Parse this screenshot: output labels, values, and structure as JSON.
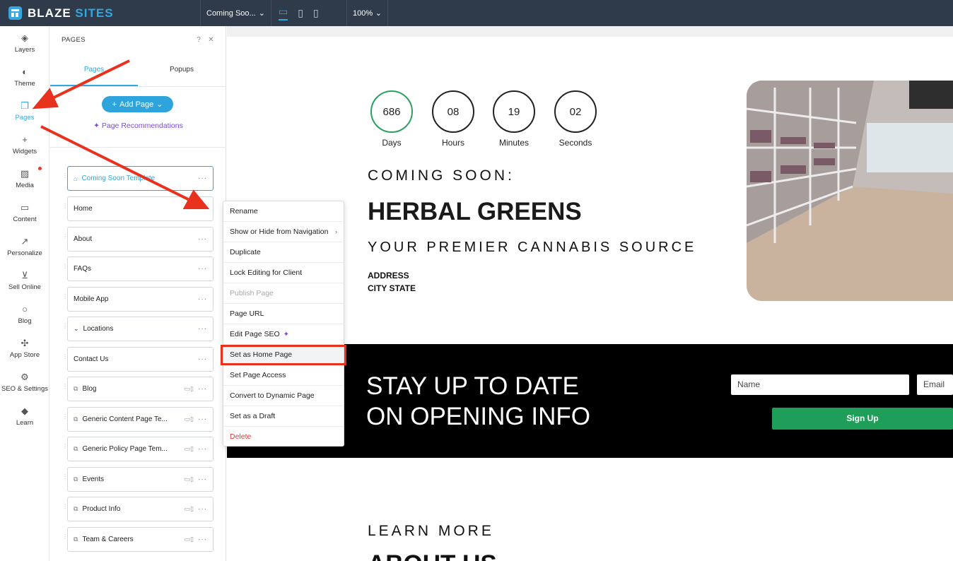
{
  "topbar": {
    "brand_a": "BLAZE",
    "brand_b": "SITES",
    "current_page": "Coming Soo...",
    "zoom": "100%"
  },
  "rail": [
    {
      "label": "Layers",
      "icon": "layers-icon"
    },
    {
      "label": "Theme",
      "icon": "palette-icon"
    },
    {
      "label": "Pages",
      "icon": "pages-icon"
    },
    {
      "label": "Widgets",
      "icon": "plus-icon"
    },
    {
      "label": "Media",
      "icon": "image-icon"
    },
    {
      "label": "Content",
      "icon": "folder-icon"
    },
    {
      "label": "Personalize",
      "icon": "personalize-icon"
    },
    {
      "label": "Sell Online",
      "icon": "cart-icon"
    },
    {
      "label": "Blog",
      "icon": "chat-icon"
    },
    {
      "label": "App Store",
      "icon": "puzzle-icon"
    },
    {
      "label": "SEO & Settings",
      "icon": "gear-icon"
    },
    {
      "label": "Learn",
      "icon": "graduation-cap-icon"
    }
  ],
  "panel": {
    "title": "PAGES",
    "tabs": [
      "Pages",
      "Popups"
    ],
    "add_page": "Add Page",
    "recommendations": "Page Recommendations",
    "pages": [
      {
        "label": "Coming Soon Template",
        "selected": true
      },
      {
        "label": "Home"
      },
      {
        "label": "About"
      },
      {
        "label": "FAQs"
      },
      {
        "label": "Mobile App"
      },
      {
        "label": "Locations"
      },
      {
        "label": "Contact Us"
      },
      {
        "label": "Blog"
      },
      {
        "label": "Generic Content Page Te..."
      },
      {
        "label": "Generic Policy Page Tem..."
      },
      {
        "label": "Events"
      },
      {
        "label": "Product Info"
      },
      {
        "label": "Team & Careers"
      }
    ]
  },
  "menu": [
    "Rename",
    "Show or Hide from Navigation",
    "Duplicate",
    "Lock Editing for Client",
    "Publish Page",
    "Page URL",
    "Edit Page SEO",
    "Set as Home Page",
    "Set Page Access",
    "Convert to Dynamic Page",
    "Set as a Draft",
    "Delete"
  ],
  "site": {
    "countdown": [
      {
        "value": "686",
        "label": "Days"
      },
      {
        "value": "08",
        "label": "Hours"
      },
      {
        "value": "19",
        "label": "Minutes"
      },
      {
        "value": "02",
        "label": "Seconds"
      }
    ],
    "coming": "COMING SOON:",
    "brand": "HERBAL GREENS",
    "tagline": "YOUR PREMIER CANNABIS SOURCE",
    "address_1": "ADDRESS",
    "address_2": "CITY STATE",
    "band_line1": "STAY UP TO DATE",
    "band_line2": "ON OPENING INFO",
    "name_placeholder": "Name",
    "email_placeholder": "Email",
    "signup": "Sign Up",
    "learn_more": "LEARN MORE",
    "about_us": "ABOUT US"
  },
  "colors": {
    "accent": "#33a7e0",
    "highlight": "#e8321e",
    "green": "#1f9e5a",
    "topbar": "#2f3a4a"
  }
}
